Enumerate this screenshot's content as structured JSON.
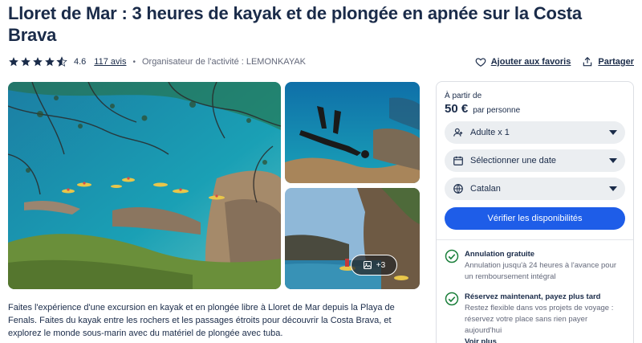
{
  "activity": {
    "title": "Lloret de Mar : 3 heures de kayak et de plongée en apnée sur la Costa Brava",
    "rating": "4.6",
    "rating_value": 4.6,
    "reviews_label": "117 avis",
    "separator": "•",
    "organizer": "Organisateur de l'activité : LEMONKAYAK",
    "description": "Faites l'expérience d'une excursion en kayak et en plongée libre à Lloret de Mar depuis la Playa de Fenals. Faites du kayak entre les rochers et les passages étroits pour découvrir la Costa Brava, et explorez le monde sous-marin avec du matériel de plongée avec tuba."
  },
  "actions": {
    "wishlist_label": "Ajouter aux favoris",
    "share_label": "Partager"
  },
  "gallery": {
    "more_label": "+3"
  },
  "booking": {
    "from_label": "À partir de",
    "price": "50 €",
    "per_label": "par personne",
    "participants": "Adulte x 1",
    "date": "Sélectionner une date",
    "language": "Catalan",
    "check_label": "Vérifier les disponibilités",
    "features": [
      {
        "title": "Annulation gratuite",
        "desc": "Annulation jusqu'à 24 heures à l'avance pour un remboursement intégral"
      },
      {
        "title": "Réservez maintenant, payez plus tard",
        "desc": "Restez flexible dans vos projets de voyage : réservez votre place sans rien payer aujourd'hui",
        "link": "Voir plus"
      }
    ]
  },
  "colors": {
    "primary": "#1e5de8",
    "text": "#1a2b49",
    "check": "#1b7f3b"
  },
  "icons": [
    "star-icon",
    "heart-icon",
    "share-icon",
    "gallery-icon",
    "user-icon",
    "calendar-icon",
    "globe-icon",
    "chevron-down-icon",
    "check-circle-icon"
  ]
}
